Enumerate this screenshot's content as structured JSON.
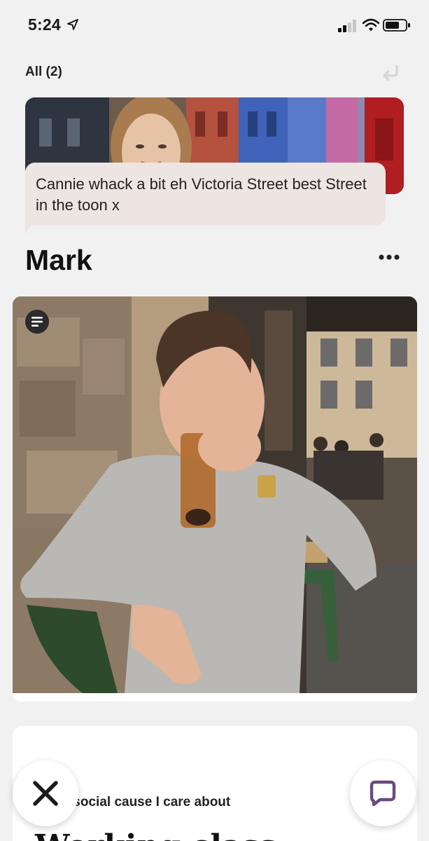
{
  "status_bar": {
    "time": "5:24",
    "icons": [
      "location-arrow-icon",
      "cellular-signal-icon",
      "wifi-icon",
      "battery-icon"
    ]
  },
  "header": {
    "filter_label": "All (2)",
    "undo_icon": "undo-icon"
  },
  "reply": {
    "message": "Cannie whack a bit eh Victoria Street best Street in the toon x"
  },
  "profile": {
    "name": "Mark",
    "more_icon": "more-dots-icon"
  },
  "prompt": {
    "label": "A social cause I care about",
    "answer": "Working class"
  },
  "actions": {
    "skip_icon": "close-icon",
    "message_icon": "chat-bubble-icon"
  },
  "colors": {
    "background": "#f2f1f1",
    "bubble": "#ede5e2",
    "accent_purple": "#6b4a7e"
  }
}
